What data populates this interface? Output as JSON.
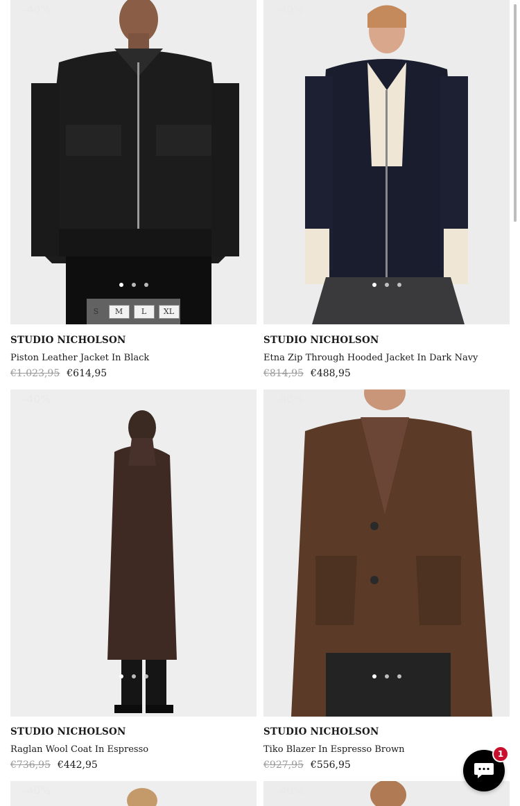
{
  "products": [
    {
      "discount": "-40%",
      "brand": "STUDIO NICHOLSON",
      "name": "Piston Leather Jacket In Black",
      "old_price": "€1.023,95",
      "new_price": "€614,95",
      "sizes": [
        "S",
        "M",
        "L",
        "XL"
      ],
      "bg": "#eeeeee"
    },
    {
      "discount": "-40%",
      "brand": "STUDIO NICHOLSON",
      "name": "Etna Zip Through Hooded Jacket In Dark Navy",
      "old_price": "€814,95",
      "new_price": "€488,95",
      "bg": "#ececec"
    },
    {
      "discount": "-40%",
      "brand": "STUDIO NICHOLSON",
      "name": "Raglan Wool Coat In Espresso",
      "old_price": "€736,95",
      "new_price": "€442,95",
      "bg": "#eeeeee"
    },
    {
      "discount": "-40%",
      "brand": "STUDIO NICHOLSON",
      "name": "Tiko Blazer In Espresso Brown",
      "old_price": "€927,95",
      "new_price": "€556,95",
      "bg": "#ececec"
    },
    {
      "discount": "-40%"
    },
    {
      "discount": "-40%"
    }
  ],
  "chat": {
    "icon": "chat-bubble-icon",
    "badge_count": "1"
  }
}
